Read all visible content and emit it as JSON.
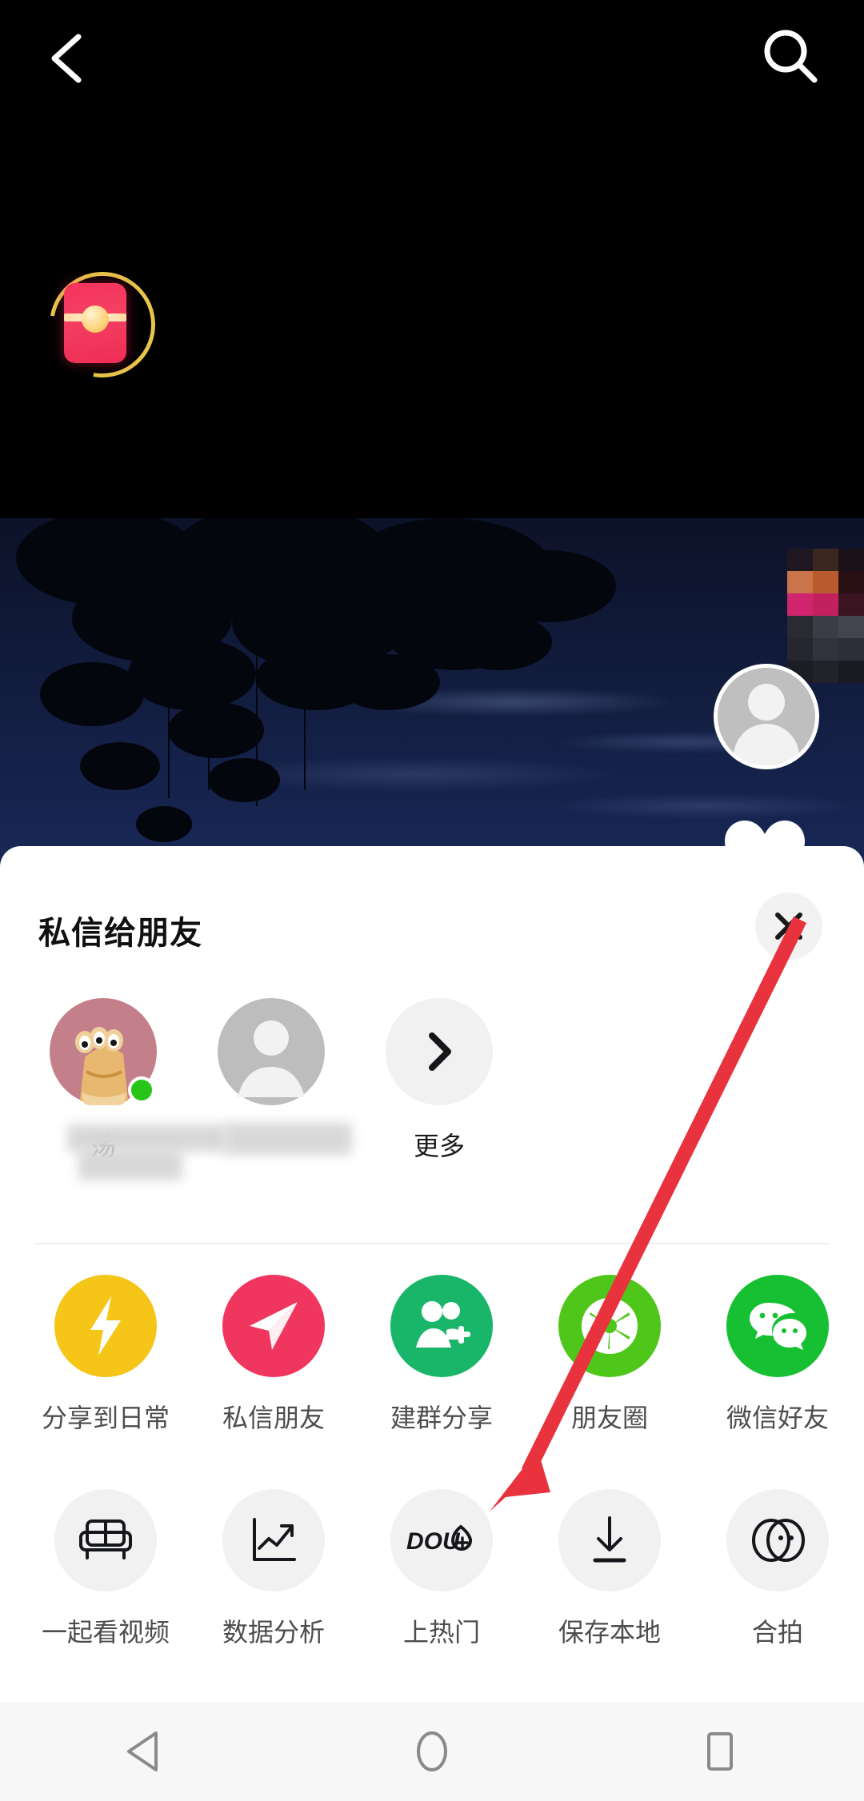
{
  "header": {
    "back_icon": "back-chevron-icon",
    "search_icon": "search-icon"
  },
  "overlay": {
    "redpacket_icon": "red-envelope-icon",
    "avatar_icon": "user-avatar-icon",
    "heart_icon": "heart-like-icon",
    "mosaic_label": "censored-block"
  },
  "sheet": {
    "title": "私信给朋友",
    "close_label": "✕",
    "contacts": [
      {
        "name": "荡",
        "redacted": true,
        "online": true,
        "avatar": "cartoon-avatar"
      },
      {
        "name": "",
        "redacted": true,
        "online": false,
        "avatar": "default-avatar"
      }
    ],
    "more_label": "更多",
    "more_icon": "chevron-right-icon",
    "row1": [
      {
        "label": "分享到日常",
        "icon": "lightning-icon",
        "color": "#f5c518"
      },
      {
        "label": "私信朋友",
        "icon": "paper-plane-icon",
        "color": "#f0365e"
      },
      {
        "label": "建群分享",
        "icon": "add-group-icon",
        "color": "#19b66a"
      },
      {
        "label": "朋友圈",
        "icon": "moments-aperture-icon",
        "color": "#4fc71a"
      },
      {
        "label": "微信好友",
        "icon": "wechat-icon",
        "color": "#16c032"
      }
    ],
    "row2": [
      {
        "label": "一起看视频",
        "icon": "sofa-icon",
        "color": "#f1f1f1"
      },
      {
        "label": "数据分析",
        "icon": "analytics-chart-icon",
        "color": "#f1f1f1"
      },
      {
        "label": "上热门",
        "icon": "dou-plus-icon",
        "color": "#f1f1f1"
      },
      {
        "label": "保存本地",
        "icon": "download-icon",
        "color": "#f1f1f1"
      },
      {
        "label": "合拍",
        "icon": "duet-icon",
        "color": "#f1f1f1"
      }
    ]
  },
  "navbar": {
    "back": "nav-back-triangle-icon",
    "home": "nav-home-circle-icon",
    "recents": "nav-recents-square-icon"
  },
  "annotation": {
    "arrow_color": "#e8333e",
    "from_label": "close-button",
    "to_label": "上热门"
  }
}
